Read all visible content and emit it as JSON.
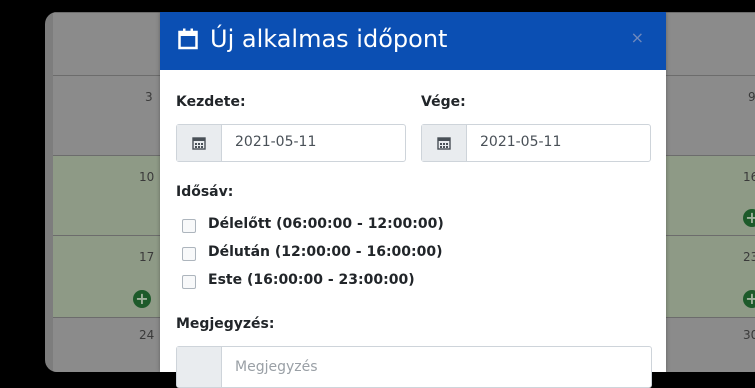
{
  "calendar": {
    "left_numbers": [
      "3",
      "10",
      "17",
      "24"
    ],
    "right_numbers": [
      "9",
      "16",
      "23",
      "30"
    ]
  },
  "modal": {
    "title": "Új alkalmas időpont",
    "close_glyph": "×",
    "start_label": "Kezdete:",
    "start_value": "2021-05-11",
    "end_label": "Vége:",
    "end_value": "2021-05-11",
    "timeslot_label": "Idősáv:",
    "timeslots": [
      "Délelőtt (06:00:00 - 12:00:00)",
      "Délután (12:00:00 - 16:00:00)",
      "Este (16:00:00 - 23:00:00)"
    ],
    "note_label": "Megjegyzés:",
    "note_placeholder": "Megjegyzés"
  },
  "colors": {
    "header_bg": "#0b4fb3",
    "backdrop": "#7d7d7d",
    "plus_icon": "#1d5a2a"
  }
}
